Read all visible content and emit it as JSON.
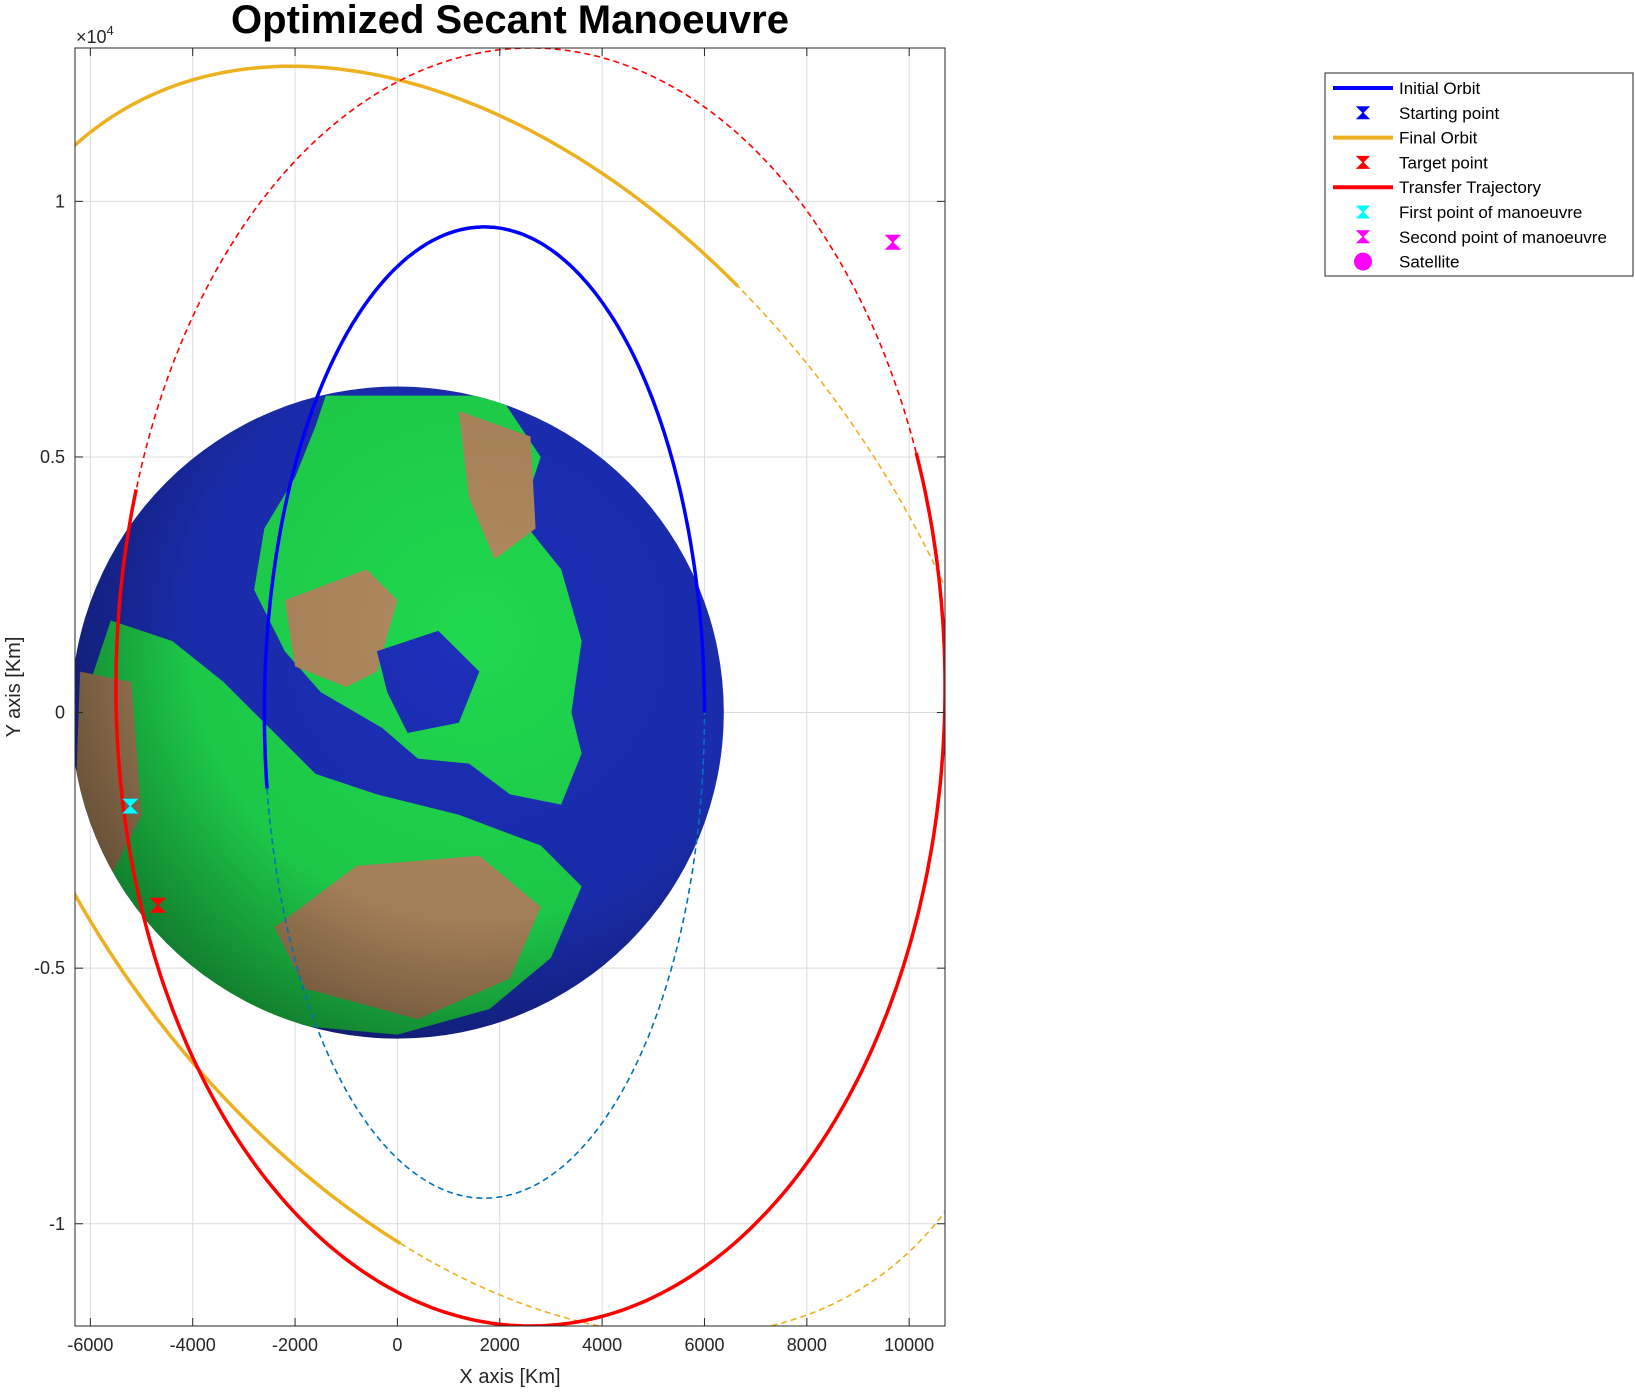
{
  "chart_data": {
    "type": "line",
    "title": "Optimized Secant Manoeuvre",
    "xlabel": "X axis [Km]",
    "ylabel": "Y axis [Km]",
    "y_exponent_label": "10",
    "y_exponent_power": "4",
    "y_exponent_prefix": "×",
    "xlim": [
      -6300,
      10700
    ],
    "ylim": [
      -12000,
      13000
    ],
    "xticks": [
      -6000,
      -4000,
      -2000,
      0,
      2000,
      4000,
      6000,
      8000,
      10000
    ],
    "xtick_labels": [
      "-6000",
      "-4000",
      "-2000",
      "0",
      "2000",
      "4000",
      "6000",
      "8000",
      "10000"
    ],
    "yticks": [
      -10000,
      -5000,
      0,
      5000,
      10000
    ],
    "ytick_labels": [
      "-1",
      "-0.5",
      "0",
      "0.5",
      "1"
    ],
    "grid": true,
    "legend_position": "outside-top-right",
    "earth": {
      "center": [
        0,
        0
      ],
      "radius": 6378,
      "colors": {
        "ocean": "#1c2fb8",
        "land": "#1fd84e",
        "desert": "#b0895e"
      }
    },
    "orbits": [
      {
        "name": "Initial Orbit",
        "color": "#0000ff",
        "center": [
          1700,
          0
        ],
        "semi_axes": [
          4300,
          9500
        ],
        "rotation_deg": 0,
        "solid_arc_deg": [
          0,
          189
        ]
      },
      {
        "name": "Final Orbit",
        "color": "#edb120",
        "center": [
          1800,
          230
        ],
        "semi_axes": [
          8900,
          13600
        ],
        "rotation_deg": 32.7,
        "solid_arc_deg": [
          18,
          216
        ]
      },
      {
        "name": "Transfer Trajectory",
        "color": "#ff0000",
        "center": [
          2600,
          500
        ],
        "semi_axes": [
          8100,
          12500
        ],
        "rotation_deg": 0,
        "solid_arc_deg": [
          -198,
          21.5
        ]
      }
    ],
    "markers": [
      {
        "name": "Starting point",
        "x": -5220,
        "y": -1830,
        "color": "#0000ff",
        "shape": "bowtie"
      },
      {
        "name": "Target point",
        "x": -4680,
        "y": -3770,
        "color": "#ff0000",
        "shape": "bowtie"
      },
      {
        "name": "First point of manoeuvre",
        "x": -5220,
        "y": -1830,
        "color": "#00ffff",
        "shape": "bowtie"
      },
      {
        "name": "Second point of manoeuvre",
        "x": 9680,
        "y": 9200,
        "color": "#ff00ff",
        "shape": "bowtie"
      }
    ],
    "legend": [
      {
        "label": "Initial Orbit",
        "color": "#0000ff",
        "kind": "line"
      },
      {
        "label": "Starting point",
        "color": "#0000ff",
        "kind": "bowtie"
      },
      {
        "label": "Final Orbit",
        "color": "#edb120",
        "kind": "line"
      },
      {
        "label": "Target point",
        "color": "#ff0000",
        "kind": "bowtie"
      },
      {
        "label": "Transfer Trajectory",
        "color": "#ff0000",
        "kind": "line"
      },
      {
        "label": "First point of manoeuvre",
        "color": "#00ffff",
        "kind": "bowtie"
      },
      {
        "label": "Second point of manoeuvre",
        "color": "#ff00ff",
        "kind": "bowtie"
      },
      {
        "label": "Satellite",
        "color": "#ff00ff",
        "kind": "dot"
      }
    ]
  }
}
